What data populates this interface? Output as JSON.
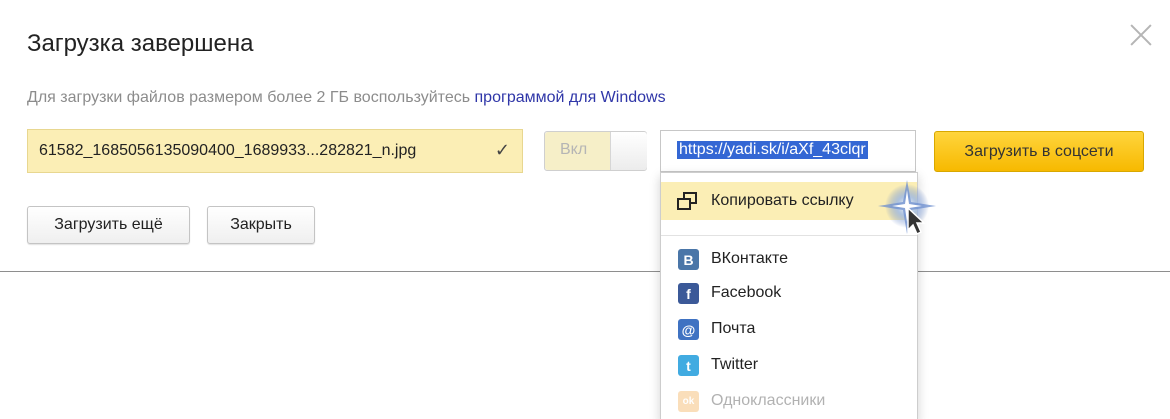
{
  "dialog": {
    "title": "Загрузка завершена",
    "hint_text": "Для загрузки файлов размером более 2 ГБ воспользуйтесь ",
    "hint_link": "программой для Windows",
    "file_name": "61582_1685056135090400_1689933...282821_n.jpg",
    "file_check": "✓",
    "toggle_label": "Вкл",
    "share_url": "https://yadi.sk/i/aXf_43clqr",
    "social_upload_label": "Загрузить в соцсети",
    "upload_more_label": "Загрузить ещё",
    "close_label": "Закрыть"
  },
  "dropdown": {
    "copy_link_label": "Копировать ссылку",
    "items": [
      {
        "label": "ВКонтакте",
        "icon": "vk-icon",
        "glyph": "B",
        "color": "#4a76a8"
      },
      {
        "label": "Facebook",
        "icon": "facebook-icon",
        "glyph": "f",
        "color": "#3b5998"
      },
      {
        "label": "Почта",
        "icon": "mail-icon",
        "glyph": "@",
        "color": "#3f72c2"
      },
      {
        "label": "Twitter",
        "icon": "twitter-icon",
        "glyph": "t",
        "color": "#41abe1"
      },
      {
        "label": "Одноклассники",
        "icon": "odnoklassniki-icon",
        "glyph": "ok",
        "color": "#f2a23c"
      }
    ]
  },
  "colors": {
    "accent_yellow": "#ffd53d",
    "highlight": "#fbeeb5",
    "link": "#2f36a8",
    "selection": "#3467d4"
  }
}
